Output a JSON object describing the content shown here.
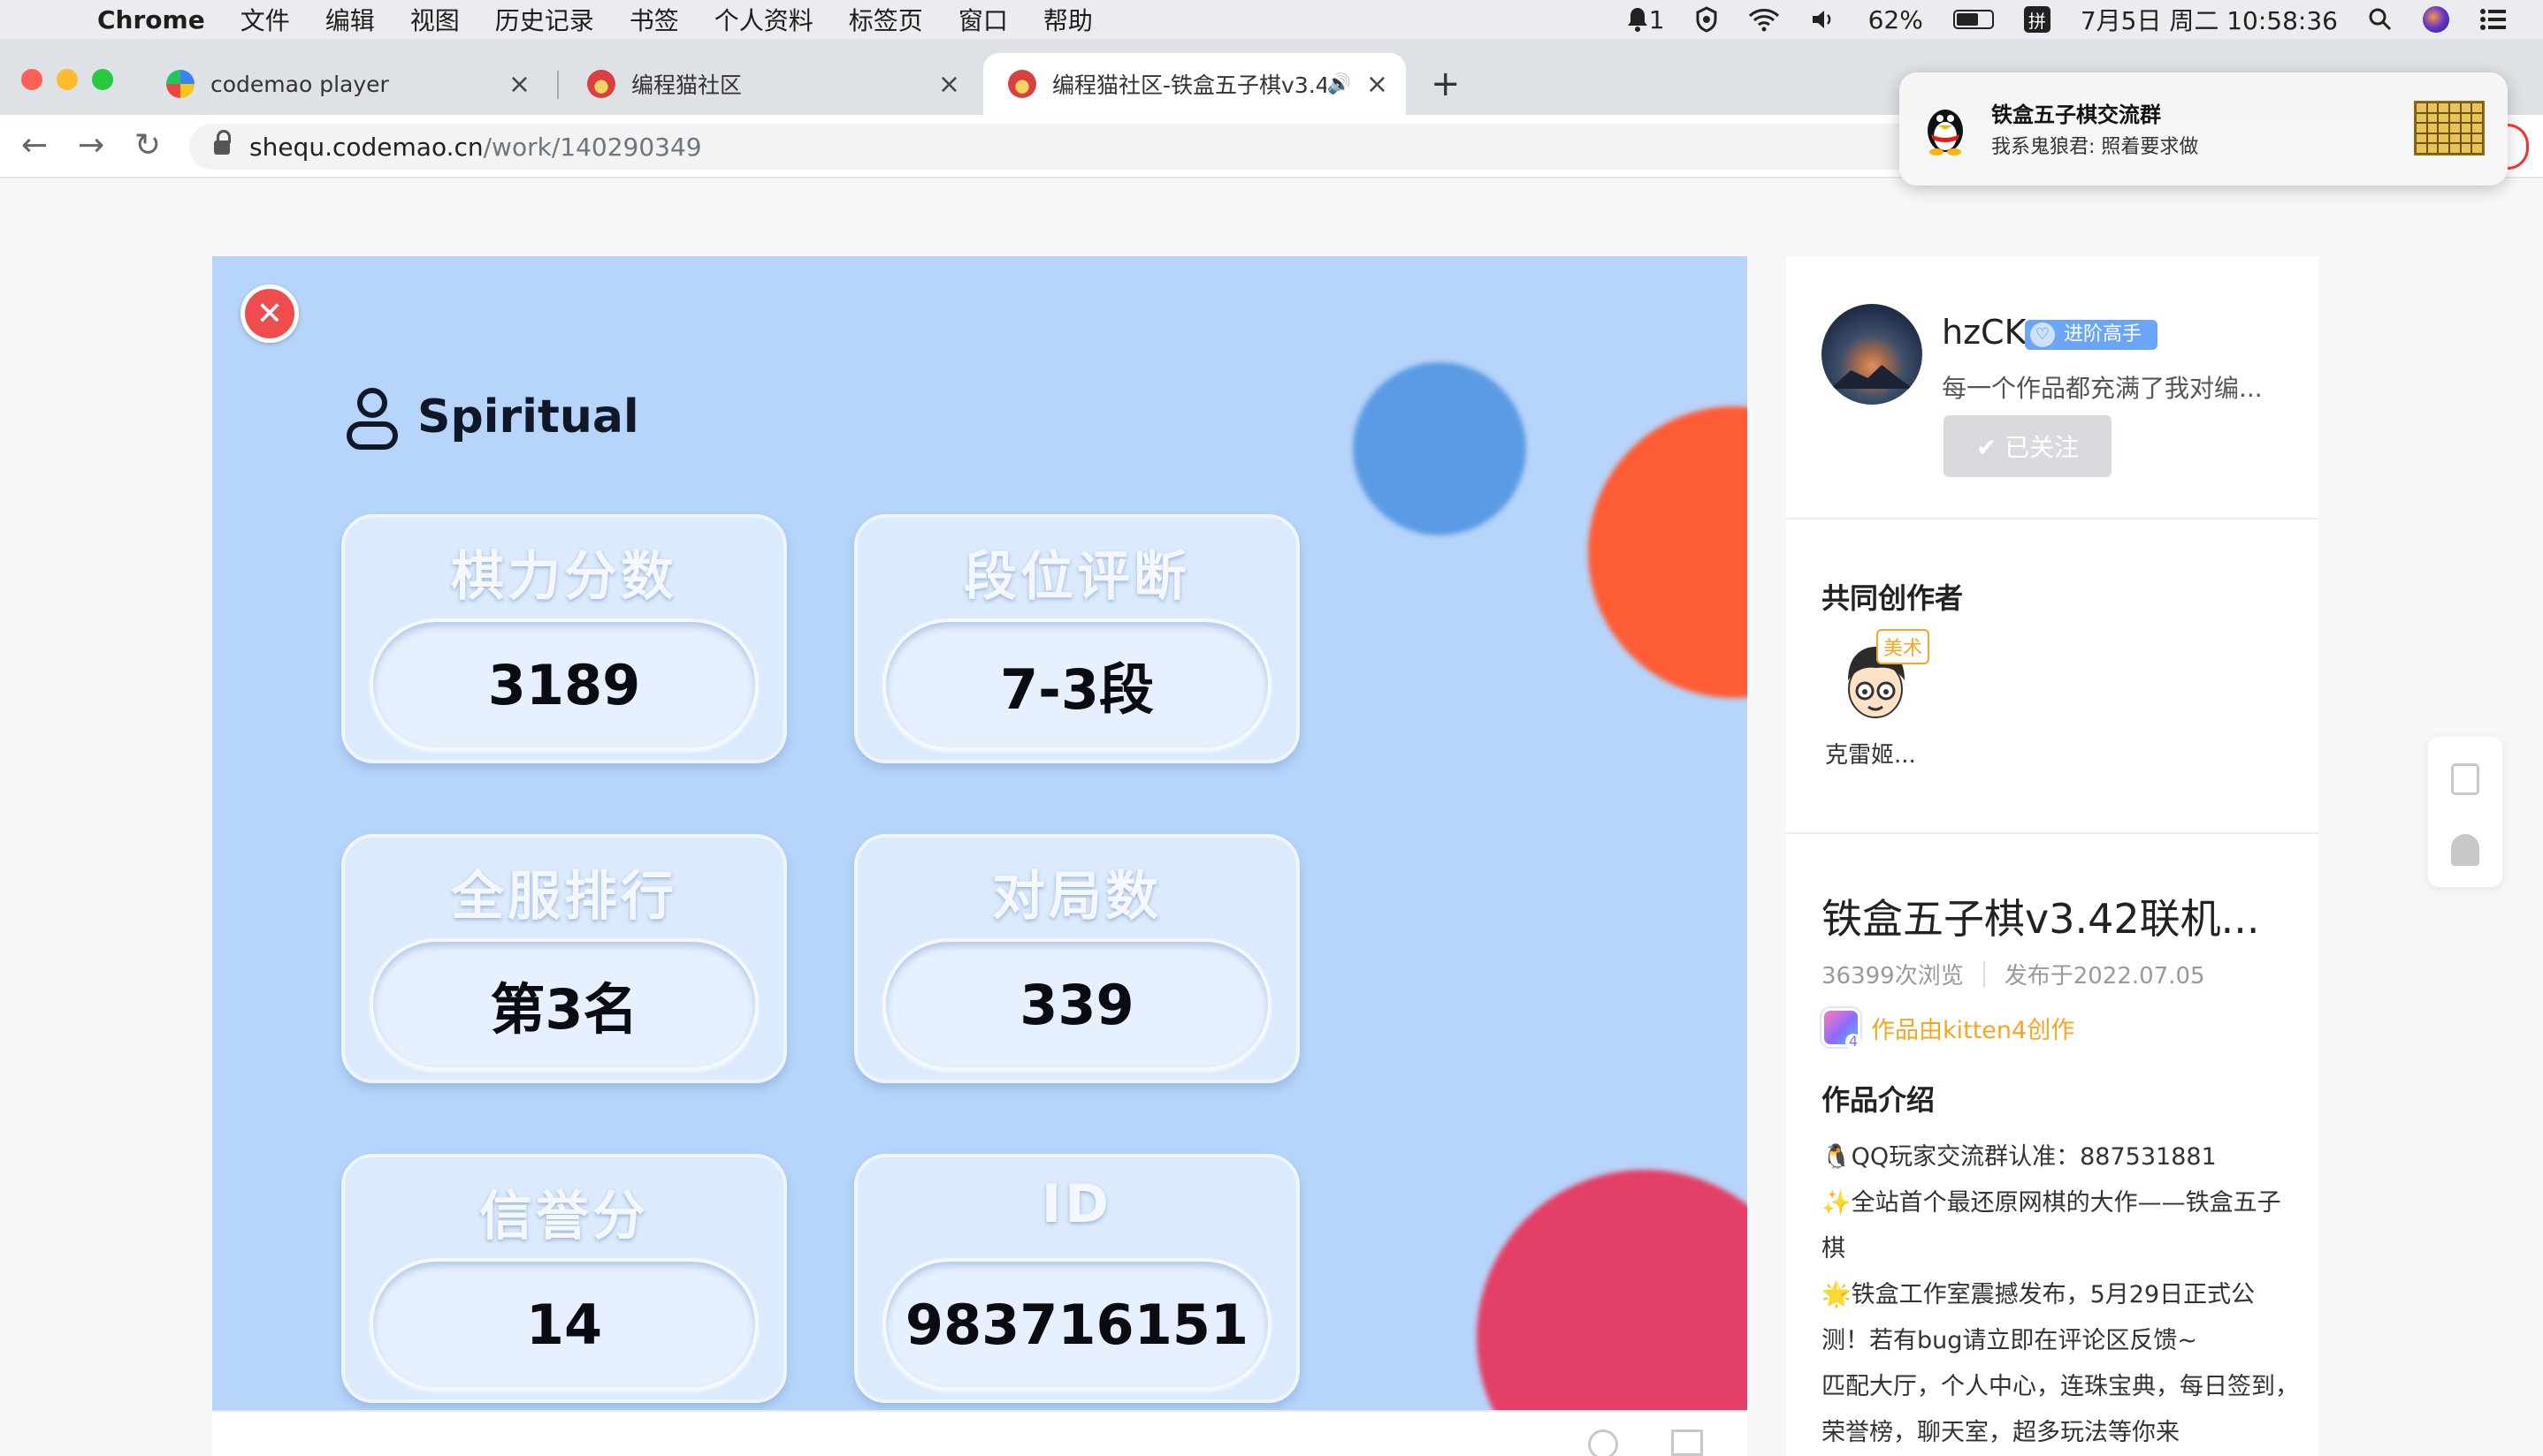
{
  "menubar": {
    "app": "Chrome",
    "items": [
      "文件",
      "编辑",
      "视图",
      "历史记录",
      "书签",
      "个人资料",
      "标签页",
      "窗口",
      "帮助"
    ],
    "notification_count": "1",
    "battery": "62%",
    "battery_level": 0.62,
    "ime": "拼",
    "datetime": "7月5日 周二  10:58:36"
  },
  "tabs": [
    {
      "title": "codemao player",
      "active": false
    },
    {
      "title": "编程猫社区",
      "active": false
    },
    {
      "title": "编程猫社区-铁盒五子棋v3.4",
      "active": true
    }
  ],
  "address": {
    "host": "shequ.codemao.cn",
    "path": "/work/140290349"
  },
  "notification": {
    "title": "铁盒五子棋交流群",
    "body": "我系鬼狼君: 照着要求做"
  },
  "game": {
    "player_name": "Spiritual",
    "stats": [
      {
        "label": "棋力分数",
        "value": "3189"
      },
      {
        "label": "段位评断",
        "value": "7-3段"
      },
      {
        "label": "全服排行",
        "value": "第3名"
      },
      {
        "label": "对局数",
        "value": "339"
      },
      {
        "label": "信誉分",
        "value": "14"
      },
      {
        "label": "ID",
        "value": "983716151"
      }
    ]
  },
  "author": {
    "name": "hzCK",
    "badge": "进阶高手",
    "bio": "每一个作品都充满了我对编...",
    "follow_label": "✔ 已关注"
  },
  "coauthors": {
    "title": "共同创作者",
    "items": [
      {
        "name": "克雷姬...",
        "role": "美术"
      }
    ]
  },
  "work": {
    "title": "铁盒五子棋v3.42联机...",
    "views": "36399次浏览",
    "published": "发布于2022.07.05",
    "creator": "作品由kitten4创作",
    "intro_title": "作品介绍",
    "intro_lines": [
      "🐧QQ玩家交流群认准：887531881",
      "✨全站首个最还原网棋的大作——铁盒五子棋",
      "🌟铁盒工作室震撼发布，5月29日正式公测！若有bug请立即在评论区反馈~",
      "匹配大厅，个人中心，连珠宝典，每日签到，荣誉榜，聊天室，超多玩法等你来"
    ]
  }
}
